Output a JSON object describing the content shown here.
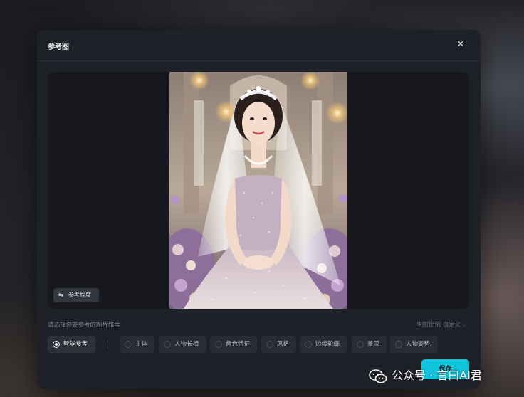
{
  "modal": {
    "title": "参考图",
    "close_label": "✕"
  },
  "preview": {
    "reference_strength_label": "参考程度",
    "reference_strength_icon": "sliders-icon"
  },
  "dimension": {
    "hint": "请选择你要参考的图片维度",
    "ratio_label": "生图比例 自定义",
    "options": [
      {
        "label": "智能参考",
        "selected": true
      },
      {
        "label": "主体",
        "selected": false
      },
      {
        "label": "人物长相",
        "selected": false
      },
      {
        "label": "角色特征",
        "selected": false
      },
      {
        "label": "风格",
        "selected": false
      },
      {
        "label": "边缘轮廓",
        "selected": false
      },
      {
        "label": "景深",
        "selected": false
      },
      {
        "label": "人物姿势",
        "selected": false
      }
    ]
  },
  "footer": {
    "save_label": "保存"
  },
  "watermark": {
    "text": "公众号 · 言曰AI君",
    "icon": "wechat-icon"
  },
  "colors": {
    "accent": "#10c4dc",
    "modal_bg": "#1f2128",
    "option_bg": "#2a2c34"
  }
}
